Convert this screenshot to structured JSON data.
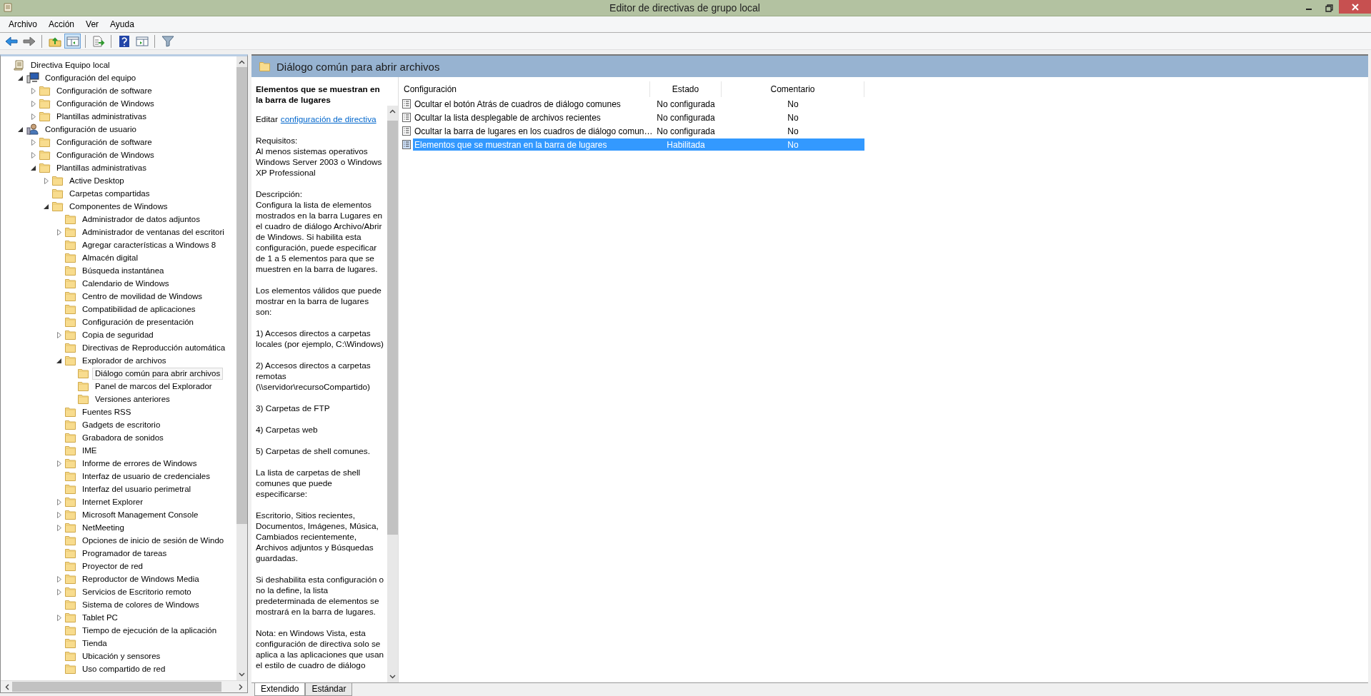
{
  "window": {
    "title": "Editor de directivas de grupo local"
  },
  "menu": [
    "Archivo",
    "Acción",
    "Ver",
    "Ayuda"
  ],
  "toolbar": [
    [
      {
        "kind": "back",
        "pressed": false
      },
      {
        "kind": "forward",
        "pressed": false
      }
    ],
    [
      {
        "kind": "up",
        "pressed": false
      },
      {
        "kind": "tree",
        "pressed": true
      }
    ],
    [
      {
        "kind": "export",
        "pressed": false
      }
    ],
    [
      {
        "kind": "help",
        "pressed": false
      },
      {
        "kind": "pane",
        "pressed": false
      }
    ],
    [
      {
        "kind": "filter",
        "pressed": false
      }
    ]
  ],
  "tree": {
    "items": [
      {
        "label": "Directiva Equipo local",
        "kind": "policy",
        "selected": false,
        "children": [
          {
            "label": "Configuración del equipo",
            "kind": "computer",
            "expanded": true,
            "selected": false,
            "children": [
              {
                "label": "Configuración de software",
                "kind": "folder",
                "expanded": false,
                "selected": false
              },
              {
                "label": "Configuración de Windows",
                "kind": "folder",
                "expanded": false,
                "selected": false
              },
              {
                "label": "Plantillas administrativas",
                "kind": "folder",
                "expanded": false,
                "selected": false
              }
            ]
          },
          {
            "label": "Configuración de usuario",
            "kind": "user",
            "expanded": true,
            "selected": false,
            "children": [
              {
                "label": "Configuración de software",
                "kind": "folder",
                "expanded": false,
                "selected": false
              },
              {
                "label": "Configuración de Windows",
                "kind": "folder",
                "expanded": false,
                "selected": false
              },
              {
                "label": "Plantillas administrativas",
                "kind": "folder",
                "expanded": true,
                "selected": false,
                "children": [
                  {
                    "label": "Active Desktop",
                    "kind": "folder",
                    "expanded": false,
                    "selected": false
                  },
                  {
                    "label": "Carpetas compartidas",
                    "kind": "folder",
                    "selected": false
                  },
                  {
                    "label": "Componentes de Windows",
                    "kind": "folder",
                    "expanded": true,
                    "selected": false,
                    "children": [
                      {
                        "label": "Administrador de datos adjuntos",
                        "kind": "folder",
                        "selected": false
                      },
                      {
                        "label": "Administrador de ventanas del escritori",
                        "kind": "folder",
                        "expanded": false,
                        "selected": false
                      },
                      {
                        "label": "Agregar características a Windows 8",
                        "kind": "folder",
                        "selected": false
                      },
                      {
                        "label": "Almacén digital",
                        "kind": "folder",
                        "selected": false
                      },
                      {
                        "label": "Búsqueda instantánea",
                        "kind": "folder",
                        "selected": false
                      },
                      {
                        "label": "Calendario de Windows",
                        "kind": "folder",
                        "selected": false
                      },
                      {
                        "label": "Centro de movilidad de Windows",
                        "kind": "folder",
                        "selected": false
                      },
                      {
                        "label": "Compatibilidad de aplicaciones",
                        "kind": "folder",
                        "selected": false
                      },
                      {
                        "label": "Configuración de presentación",
                        "kind": "folder",
                        "selected": false
                      },
                      {
                        "label": "Copia de seguridad",
                        "kind": "folder",
                        "expanded": false,
                        "selected": false
                      },
                      {
                        "label": "Directivas de Reproducción automática",
                        "kind": "folder",
                        "selected": false
                      },
                      {
                        "label": "Explorador de archivos",
                        "kind": "folder",
                        "expanded": true,
                        "selected": false,
                        "children": [
                          {
                            "label": "Diálogo común para abrir archivos",
                            "kind": "folder",
                            "selected": true
                          },
                          {
                            "label": "Panel de marcos del Explorador",
                            "kind": "folder",
                            "selected": false
                          },
                          {
                            "label": "Versiones anteriores",
                            "kind": "folder",
                            "selected": false
                          }
                        ]
                      },
                      {
                        "label": "Fuentes RSS",
                        "kind": "folder",
                        "selected": false
                      },
                      {
                        "label": "Gadgets de escritorio",
                        "kind": "folder",
                        "selected": false
                      },
                      {
                        "label": "Grabadora de sonidos",
                        "kind": "folder",
                        "selected": false
                      },
                      {
                        "label": "IME",
                        "kind": "folder",
                        "selected": false
                      },
                      {
                        "label": "Informe de errores de Windows",
                        "kind": "folder",
                        "expanded": false,
                        "selected": false
                      },
                      {
                        "label": "Interfaz de usuario de credenciales",
                        "kind": "folder",
                        "selected": false
                      },
                      {
                        "label": "Interfaz del usuario perimetral",
                        "kind": "folder",
                        "selected": false
                      },
                      {
                        "label": "Internet Explorer",
                        "kind": "folder",
                        "expanded": false,
                        "selected": false
                      },
                      {
                        "label": "Microsoft Management Console",
                        "kind": "folder",
                        "expanded": false,
                        "selected": false
                      },
                      {
                        "label": "NetMeeting",
                        "kind": "folder",
                        "expanded": false,
                        "selected": false
                      },
                      {
                        "label": "Opciones de inicio de sesión de Windo",
                        "kind": "folder",
                        "selected": false
                      },
                      {
                        "label": "Programador de tareas",
                        "kind": "folder",
                        "selected": false
                      },
                      {
                        "label": "Proyector de red",
                        "kind": "folder",
                        "selected": false
                      },
                      {
                        "label": "Reproductor de Windows Media",
                        "kind": "folder",
                        "expanded": false,
                        "selected": false
                      },
                      {
                        "label": "Servicios de Escritorio remoto",
                        "kind": "folder",
                        "expanded": false,
                        "selected": false
                      },
                      {
                        "label": "Sistema de colores de Windows",
                        "kind": "folder",
                        "selected": false
                      },
                      {
                        "label": "Tablet PC",
                        "kind": "folder",
                        "expanded": false,
                        "selected": false
                      },
                      {
                        "label": "Tiempo de ejecución de la aplicación",
                        "kind": "folder",
                        "selected": false
                      },
                      {
                        "label": "Tienda",
                        "kind": "folder",
                        "selected": false
                      },
                      {
                        "label": "Ubicación y sensores",
                        "kind": "folder",
                        "selected": false
                      },
                      {
                        "label": "Uso compartido de red",
                        "kind": "folder",
                        "selected": false
                      }
                    ]
                  }
                ]
              }
            ]
          }
        ]
      }
    ]
  },
  "header": {
    "title": "Diálogo común para abrir archivos"
  },
  "description": {
    "title": "Elementos que se muestran en la barra de lugares",
    "edit_label": "Editar",
    "edit_link": "configuración de directiva",
    "paragraphs": [
      "Requisitos:\nAl menos sistemas operativos Windows Server 2003 o Windows XP Professional",
      "Descripción:\nConfigura la lista de elementos mostrados en la barra Lugares en el cuadro de diálogo Archivo/Abrir de Windows. Si habilita esta configuración, puede especificar de 1 a 5 elementos para que se muestren en la barra de lugares.",
      "Los elementos válidos que puede mostrar en la barra de lugares son:",
      "1) Accesos directos a carpetas locales (por ejemplo, C:\\Windows)",
      "2) Accesos directos a carpetas remotas (\\\\servidor\\recursoCompartido)",
      "3) Carpetas de FTP",
      "4) Carpetas web",
      "5) Carpetas de shell comunes.",
      "La lista de carpetas de shell comunes que puede especificarse:",
      "Escritorio, Sitios recientes, Documentos, Imágenes, Música, Cambiados recientemente, Archivos adjuntos y Búsquedas guardadas.",
      "Si deshabilita esta configuración o no la define, la lista predeterminada de elementos se mostrará en la barra de lugares.",
      "Nota: en Windows Vista, esta configuración de directiva solo se aplica a las aplicaciones que usan el estilo de cuadro de diálogo"
    ]
  },
  "table": {
    "columns": [
      "Configuración",
      "Estado",
      "Comentario"
    ],
    "rows": [
      {
        "setting": "Ocultar el botón Atrás de cuadros de diálogo comunes",
        "state": "No configurada",
        "comment": "No",
        "selected": false
      },
      {
        "setting": "Ocultar la lista desplegable de archivos recientes",
        "state": "No configurada",
        "comment": "No",
        "selected": false
      },
      {
        "setting": "Ocultar la barra de lugares en los cuadros de diálogo comun…",
        "state": "No configurada",
        "comment": "No",
        "selected": false
      },
      {
        "setting": "Elementos que se muestran en la barra de lugares",
        "state": "Habilitada",
        "comment": "No",
        "selected": true
      }
    ]
  },
  "tabs": [
    {
      "label": "Extendido",
      "selected": true
    },
    {
      "label": "Estándar",
      "selected": false
    }
  ]
}
